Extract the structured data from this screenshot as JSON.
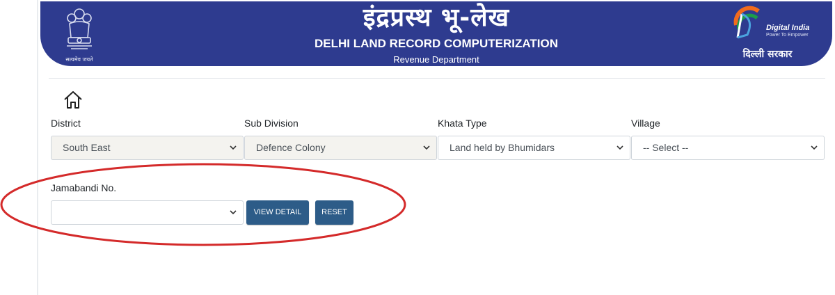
{
  "header": {
    "title_hindi": "इंद्रप्रस्थ भू-लेख",
    "title_en": "DELHI LAND RECORD COMPUTERIZATION",
    "department": "Revenue Department",
    "emblem_motto": "सत्यमेव जयते",
    "digital_india": "Digital India",
    "digital_india_tag": "Power To Empower",
    "delhi_sarkar": "दिल्ली सरकार"
  },
  "icons": {
    "home": "home-icon",
    "chevron": "chevron-down-icon",
    "emblem": "emblem-icon",
    "digital_india_logo": "digital-india-logo-icon"
  },
  "form": {
    "district": {
      "label": "District",
      "value": "South East"
    },
    "sub_division": {
      "label": "Sub Division",
      "value": "Defence Colony"
    },
    "khata_type": {
      "label": "Khata Type",
      "value": "Land held by Bhumidars"
    },
    "village": {
      "label": "Village",
      "value": "-- Select --"
    },
    "jamabandi": {
      "label": "Jamabandi No.",
      "value": ""
    },
    "view_detail_label": "VIEW DETAIL",
    "reset_label": "RESET"
  },
  "colors": {
    "header_bg": "#2e3b8f",
    "button_bg": "#2d5c88",
    "annotation_ellipse": "#d42a2a",
    "disabled_select_bg": "#f4f3ef"
  }
}
